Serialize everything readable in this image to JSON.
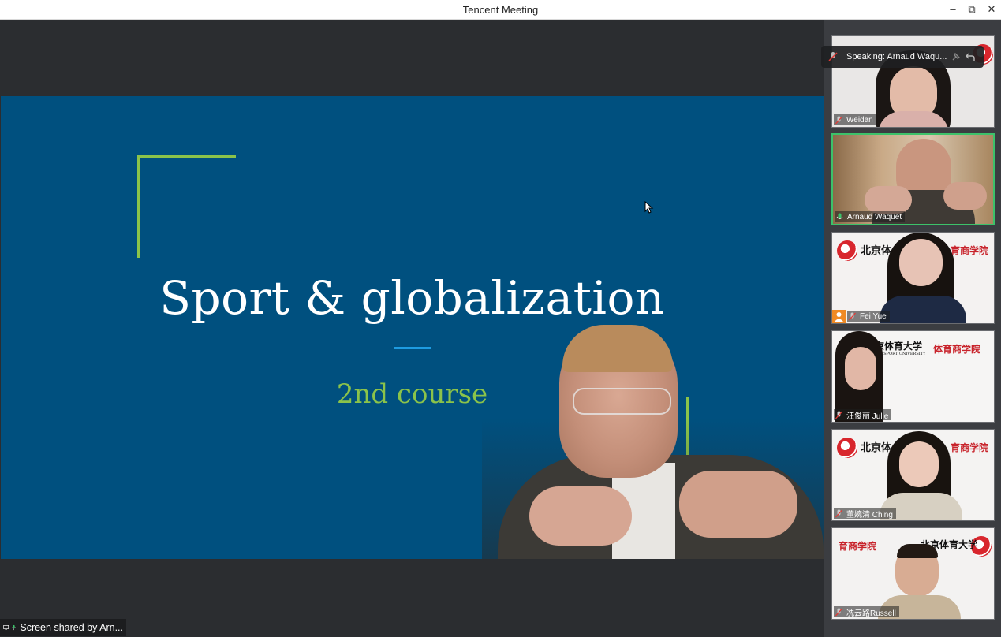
{
  "window": {
    "title": "Tencent Meeting",
    "minimize": "–",
    "maximize": "⧉",
    "close": "✕"
  },
  "slide": {
    "title": "Sport & globalization",
    "subtitle": "2nd course",
    "bg_color": "#00507f",
    "accent_green": "#8bc34a",
    "accent_blue": "#1e9be0"
  },
  "share_bar": {
    "text": "Screen shared by Arn..."
  },
  "speaking_banner": {
    "text": "Speaking: Arnaud Waqu..."
  },
  "participants": [
    {
      "name": "Weidan",
      "mic": "muted"
    },
    {
      "name": "Arnaud Waquet",
      "mic": "active"
    },
    {
      "name": "Fei Yue",
      "mic": "muted",
      "badge": "avatar-icon"
    },
    {
      "name": "汪俊丽 Julie",
      "mic": "muted"
    },
    {
      "name": "董婉清 Ching",
      "mic": "muted"
    },
    {
      "name": "冼云路Russell",
      "mic": "muted"
    }
  ],
  "logos": {
    "bsu_left": "北京体",
    "bsu_right": "体育商学院",
    "bsu_right_short": "育商学院",
    "bsu_full": "北京体育大学",
    "bsu_sub": "BEIJING SPORT UNIVERSITY"
  }
}
